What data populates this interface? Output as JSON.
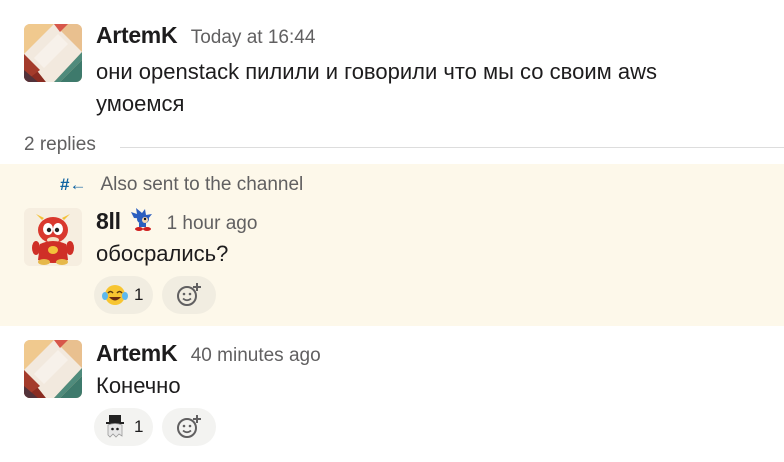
{
  "thread": {
    "replies_label": "2 replies",
    "also_sent_icon": "#←",
    "also_sent_label": "Also sent to the channel"
  },
  "messages": [
    {
      "author": "ArtemK",
      "time": "Today at 16:44",
      "text_line1": "они openstack пилили и говорили что мы со своим aws",
      "text_line2": "умоемся",
      "avatar_icon": "geometric-pattern-avatar"
    },
    {
      "author": "8ll",
      "time": "1 hour ago",
      "text": "обосрались?",
      "avatar_icon": "cartoon-character-avatar",
      "status_emoji": "sonic-emoji-icon",
      "reactions": [
        {
          "emoji": "joy-emoji",
          "count": "1"
        }
      ]
    },
    {
      "author": "ArtemK",
      "time": "40 minutes ago",
      "text": "Конечно",
      "avatar_icon": "geometric-pattern-avatar",
      "reactions": [
        {
          "emoji": "top-hat-ghost-emoji",
          "count": "1"
        }
      ]
    }
  ],
  "colors": {
    "highlight_bg": "#fdf8ea",
    "link_blue": "#1264a3",
    "muted_text": "#616061"
  }
}
